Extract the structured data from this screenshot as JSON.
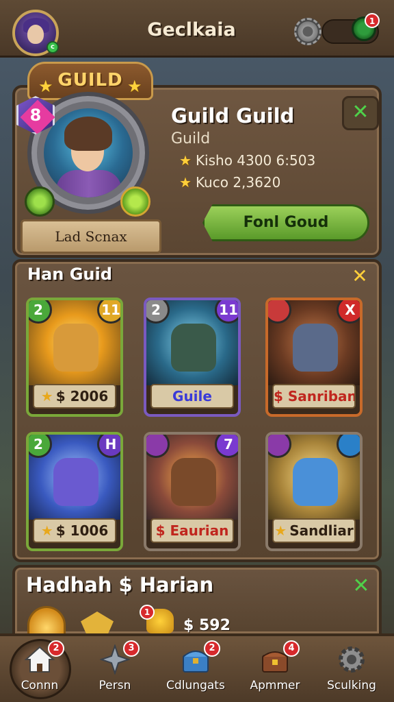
{
  "header": {
    "title": "Geclkaia",
    "notification_count": "1",
    "avatar_status": "c"
  },
  "profile": {
    "banner": "GUILD",
    "rank_icon": "8",
    "name_plate": "Lad Scnax",
    "title": "Guild Guild",
    "subtitle": "Guild",
    "stats": [
      {
        "label": "Kisho 4300 6:503"
      },
      {
        "label": "Kuco 2,3620"
      }
    ],
    "action_button": "Fonl Goud"
  },
  "guild_list": {
    "title": "Han Guid",
    "cards": [
      {
        "label": "$ 2006",
        "left": "2",
        "right": "11",
        "left_color": "#4aa83a",
        "right_color": "#e0a826",
        "label_color": "#2e1f12",
        "star": true
      },
      {
        "label": "Guile",
        "left": "2",
        "right": "11",
        "left_color": "#8a8a8a",
        "right_color": "#7a3ad0",
        "label_color": "#3a3ad8",
        "star": false
      },
      {
        "label": "$ Sanriban",
        "left": "",
        "right": "X",
        "left_color": "#c83a3a",
        "right_color": "#d02a2a",
        "label_color": "#c0261e",
        "star": false
      },
      {
        "label": "$ 1006",
        "left": "2",
        "right": "H",
        "left_color": "#4aa83a",
        "right_color": "#6a3ac0",
        "label_color": "#2e1f12",
        "star": true
      },
      {
        "label": "$ Eaurian",
        "left": "",
        "right": "7",
        "left_color": "#8a3aa8",
        "right_color": "#7a3ad0",
        "label_color": "#c0261e",
        "star": false
      },
      {
        "label": "Sandliar",
        "left": "",
        "right": "",
        "left_color": "#8a3aa8",
        "right_color": "#2a80c8",
        "label_color": "#2e1f12",
        "star": true
      }
    ]
  },
  "rewards": {
    "title": "Hadhah $ Harian",
    "pile_badge": "1",
    "amount": "$ 592"
  },
  "nav": [
    {
      "label": "Connn",
      "badge": "2",
      "icon": "home-icon"
    },
    {
      "label": "Persn",
      "badge": "3",
      "icon": "shuriken-icon"
    },
    {
      "label": "Cdlungats",
      "badge": "2",
      "icon": "chest-icon"
    },
    {
      "label": "Apmmer",
      "badge": "4",
      "icon": "treasure-icon"
    },
    {
      "label": "Sculking",
      "badge": "",
      "icon": "gear-icon"
    }
  ]
}
